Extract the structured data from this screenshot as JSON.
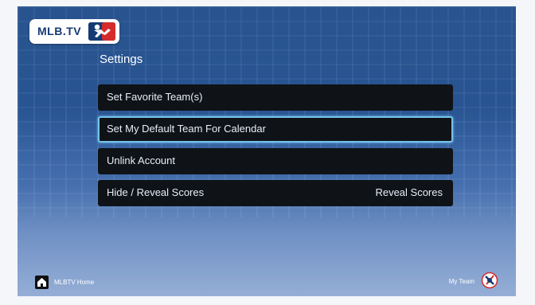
{
  "branding": {
    "logo_text": "MLB.TV"
  },
  "page": {
    "title": "Settings"
  },
  "menu": {
    "items": [
      {
        "label": "Set Favorite Team(s)",
        "value": ""
      },
      {
        "label": "Set My Default Team For Calendar",
        "value": ""
      },
      {
        "label": "Unlink Account",
        "value": ""
      },
      {
        "label": "Hide / Reveal Scores",
        "value": "Reveal Scores"
      }
    ]
  },
  "footer": {
    "home_label": "MLBTV Home",
    "my_team_label": "My Team"
  },
  "colors": {
    "background_top": "#2f5f9e",
    "background_bottom": "#95aed6",
    "menu_bg": "#0f1318",
    "selected_border": "#75c3ea",
    "logo_navy": "#163a73",
    "logo_red": "#d52b2b"
  },
  "icons": {
    "home": "home-icon",
    "my_team": "team-logo-icon",
    "logo": "mlb-logo-icon"
  }
}
